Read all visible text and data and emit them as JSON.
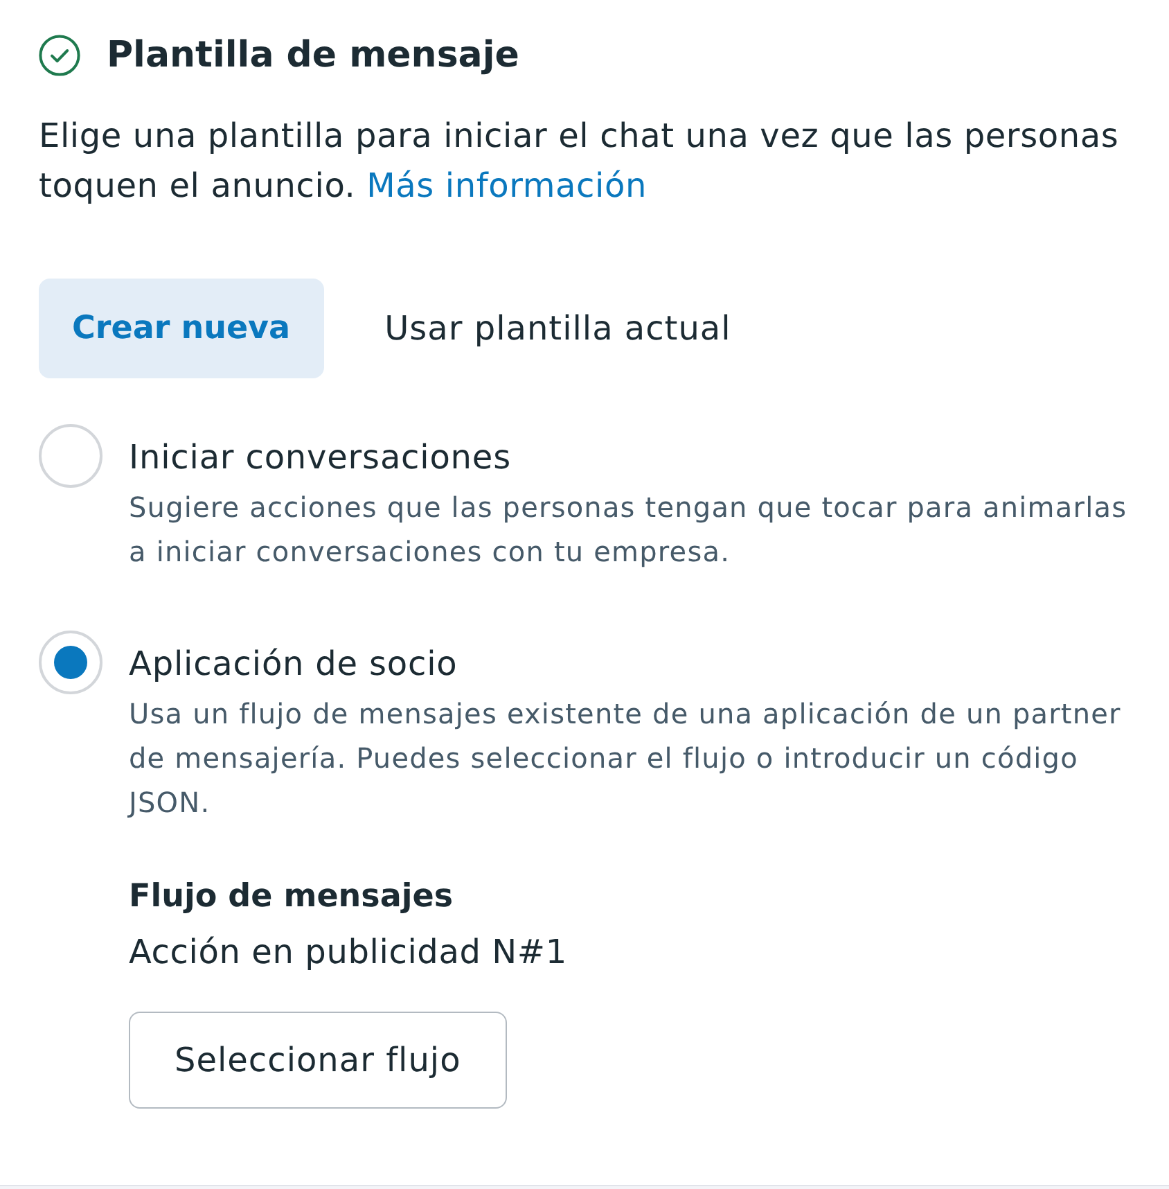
{
  "section": {
    "title": "Plantilla de mensaje",
    "completed": true,
    "description": "Elige una plantilla para iniciar el chat una vez que las personas toquen el anuncio.",
    "link": "Más información"
  },
  "tabs": [
    {
      "label": "Crear nueva",
      "selected": true
    },
    {
      "label": "Usar plantilla actual",
      "selected": false
    }
  ],
  "options": [
    {
      "label": "Iniciar conversaciones",
      "description": "Sugiere acciones que las personas tengan que tocar para animarlas a iniciar conversaciones con tu empresa.",
      "selected": false
    },
    {
      "label": "Aplicación de socio",
      "description": "Usa un flujo de mensajes existente de una aplicación de un partner de mensajería. Puedes seleccionar el flujo o introducir un código JSON.",
      "selected": true,
      "flow": {
        "heading": "Flujo de mensajes",
        "value": "Acción en publicidad N#1",
        "button": "Seleccionar flujo"
      }
    }
  ]
}
